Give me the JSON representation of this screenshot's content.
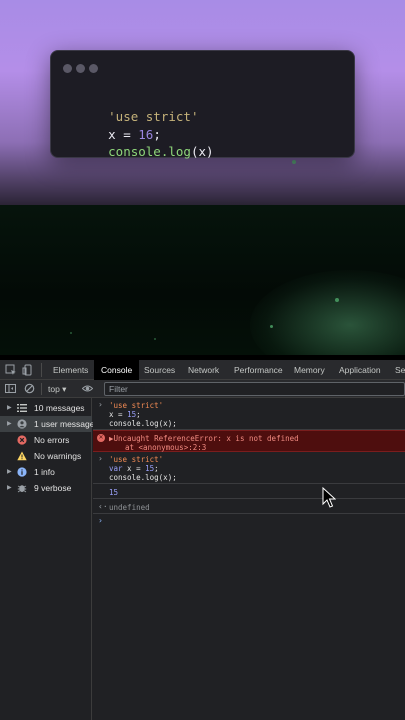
{
  "code_card": {
    "line1": "'use strict'",
    "line2_var": "x",
    "line2_eq": " = ",
    "line2_num": "16",
    "line2_end": ";",
    "line3_fn": "console.log",
    "line3_args": "(x)"
  },
  "devtools": {
    "tabs": [
      "Elements",
      "Console",
      "Sources",
      "Network",
      "Performance",
      "Memory",
      "Application",
      "Se"
    ],
    "active_tab": "Console",
    "context": "top ▾",
    "filter_placeholder": "Filter"
  },
  "sidebar": {
    "items": [
      {
        "label": "10 messages",
        "icon": "list-icon"
      },
      {
        "label": "1 user message",
        "icon": "user-icon"
      },
      {
        "label": "No errors",
        "icon": "error-icon"
      },
      {
        "label": "No warnings",
        "icon": "warning-icon"
      },
      {
        "label": "1 info",
        "icon": "info-icon"
      },
      {
        "label": "9 verbose",
        "icon": "bug-icon"
      }
    ]
  },
  "console": {
    "input1": {
      "l1": "'use strict'",
      "l2_var": "x",
      "l2_rest": " = ",
      "l2_num": "15",
      "l2_end": ";",
      "l3": "console.log(x);"
    },
    "error": {
      "message": "Uncaught ReferenceError: x is not defined",
      "location": "at <anonymous>:2:3"
    },
    "input2": {
      "l1": "'use strict'",
      "l2_kw": "var",
      "l2_var": " x = ",
      "l2_num": "15",
      "l2_end": ";",
      "l3": "console.log(x);"
    },
    "output": "15",
    "result": "undefined"
  },
  "colors": {
    "error_bg": "#4e0e0e",
    "error_text": "#f28b82",
    "string": "#f28b54",
    "number": "#9aa0f9"
  }
}
